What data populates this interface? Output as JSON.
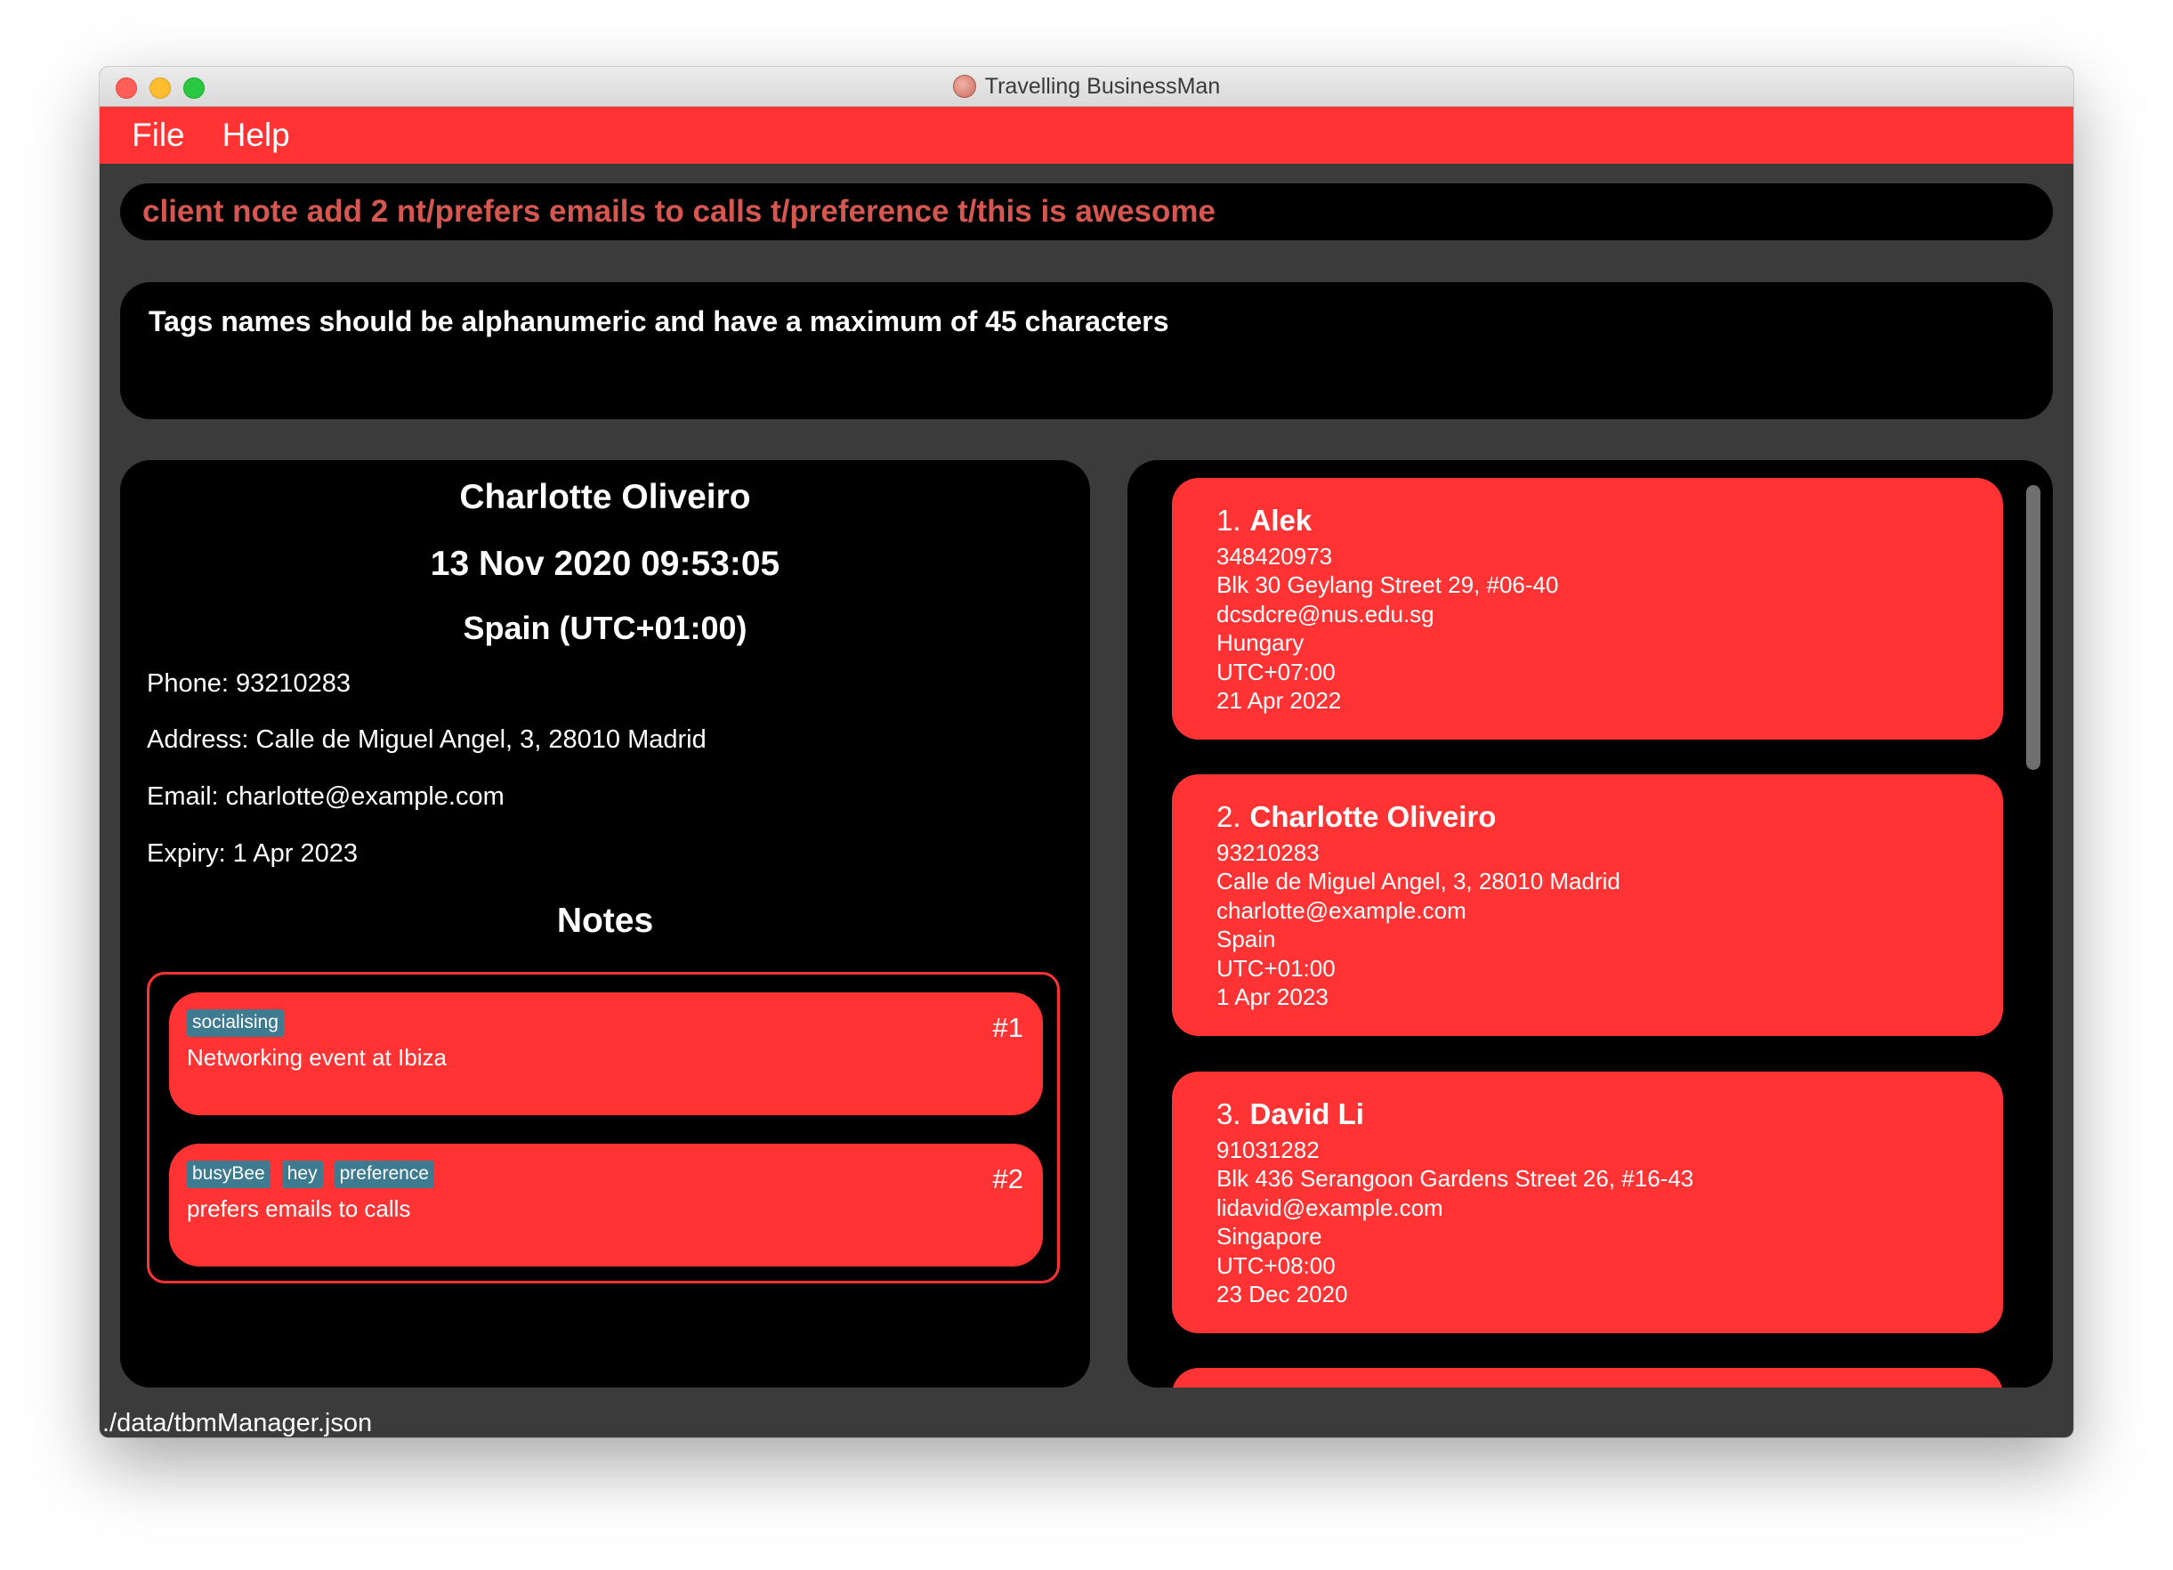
{
  "window": {
    "title": "Travelling BusinessMan"
  },
  "menu": {
    "file": "File",
    "help": "Help"
  },
  "command": {
    "value": "client note add 2 nt/prefers emails to calls t/preference t/this is awesome"
  },
  "result": {
    "message": "Tags names should be alphanumeric and have a maximum of 45 characters"
  },
  "detail": {
    "name": "Charlotte Oliveiro",
    "datetime": "13 Nov 2020 09:53:05",
    "country": "Spain (UTC+01:00)",
    "phone": "Phone: 93210283",
    "address": "Address: Calle de Miguel Angel, 3, 28010 Madrid",
    "email": "Email: charlotte@example.com",
    "expiry": "Expiry: 1 Apr 2023",
    "notes_heading": "Notes",
    "notes": [
      {
        "tags": [
          "socialising"
        ],
        "number": "#1",
        "text": "Networking event at Ibiza"
      },
      {
        "tags": [
          "busyBee",
          "hey",
          "preference"
        ],
        "number": "#2",
        "text": "prefers emails to calls"
      }
    ]
  },
  "clients": [
    {
      "index": "1.",
      "name": "Alek",
      "phone": "348420973",
      "address": "Blk 30 Geylang Street 29, #06-40",
      "email": "dcsdcre@nus.edu.sg",
      "country": "Hungary",
      "timezone": "UTC+07:00",
      "expiry": "21 Apr 2022"
    },
    {
      "index": "2.",
      "name": "Charlotte Oliveiro",
      "phone": "93210283",
      "address": "Calle de Miguel Angel, 3, 28010 Madrid",
      "email": "charlotte@example.com",
      "country": "Spain",
      "timezone": "UTC+01:00",
      "expiry": "1 Apr 2023"
    },
    {
      "index": "3.",
      "name": "David Li",
      "phone": "91031282",
      "address": "Blk 436 Serangoon Gardens Street 26, #16-43",
      "email": "lidavid@example.com",
      "country": "Singapore",
      "timezone": "UTC+08:00",
      "expiry": "23 Dec 2020"
    }
  ],
  "status": {
    "file_path": "./data/tbmManager.json"
  },
  "colors": {
    "accent": "#ff3333",
    "panel": "#000000",
    "background": "#3b3b3b",
    "command_text": "#d6574f",
    "tag": "#3e7b91"
  }
}
